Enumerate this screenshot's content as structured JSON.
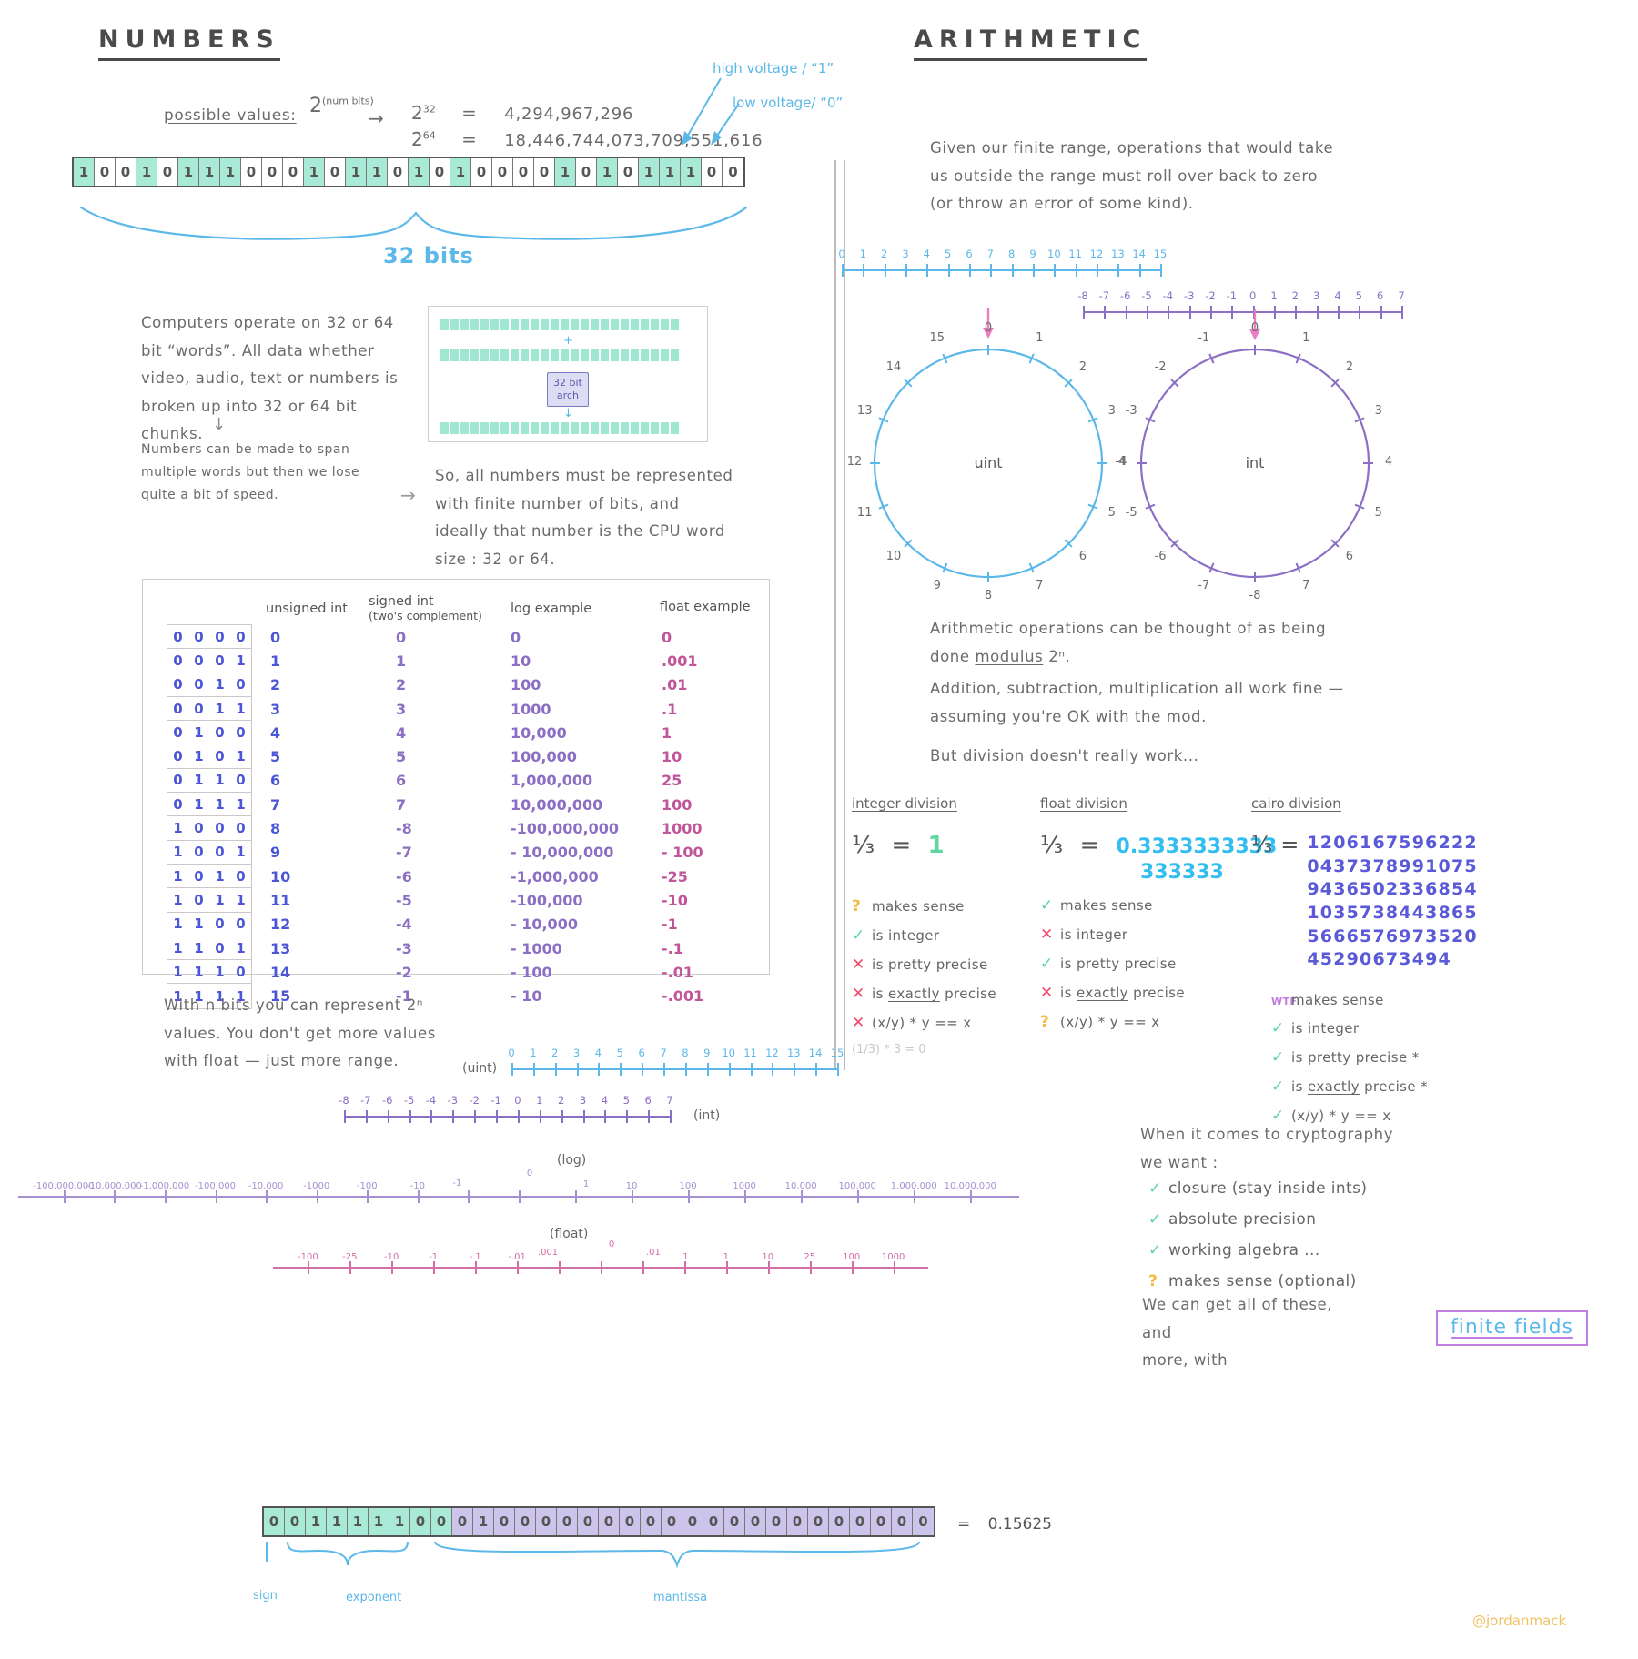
{
  "sections": {
    "left_title": "NUMBERS",
    "right_title": "ARITHMETIC"
  },
  "numbers": {
    "possible_values_label": "possible values:",
    "formula_base": "2",
    "formula_exp": "(num bits)",
    "arrow": "→",
    "rows": [
      {
        "power": "2",
        "exp": "32",
        "eq": "=",
        "value": "4,294,967,296"
      },
      {
        "power": "2",
        "exp": "64",
        "eq": "=",
        "value": "18,446,744,073,709,551,616"
      }
    ],
    "voltage_high": "high voltage / “1”",
    "voltage_low": "low voltage/ “0”",
    "bits32": [
      1,
      0,
      0,
      1,
      0,
      1,
      1,
      1,
      0,
      0,
      0,
      1,
      0,
      1,
      1,
      0,
      1,
      0,
      1,
      0,
      0,
      0,
      0,
      1,
      0,
      1,
      0,
      1,
      1,
      1,
      0,
      0
    ],
    "brace_label": "32 bits",
    "words_paragraph": "Computers operate on 32 or 64 bit “words”.  All data whether  video, audio, text or numbers is broken up into 32 or 64 bit chunks.",
    "span_paragraph": "Numbers can be made to span multiple words but then we lose quite a bit of speed.",
    "arch_chip_line1": "32 bit",
    "arch_chip_line2": "arch",
    "arch_plus": "+",
    "arch_down": "↓",
    "finite_paragraph": "So,  all  numbers  must be represented with finite number of bits, and ideally that number is the CPU word size :  32  or  64.",
    "with_n_bits_paragraph": "With n bits you can represent 2ⁿ values. You don't get more values with float — just more range."
  },
  "table": {
    "headers": [
      "unsigned int",
      "signed int\n(two's complement)",
      "log example",
      "float example"
    ],
    "header_signed_top": "signed int",
    "header_signed_bot": "(two's complement)",
    "rows": [
      {
        "bits": "0 0 0 0",
        "unsigned": "0",
        "signed": "0",
        "log": "0",
        "float": "0"
      },
      {
        "bits": "0 0 0 1",
        "unsigned": "1",
        "signed": "1",
        "log": "10",
        "float": ".001"
      },
      {
        "bits": "0 0 1 0",
        "unsigned": "2",
        "signed": "2",
        "log": "100",
        "float": ".01"
      },
      {
        "bits": "0 0 1 1",
        "unsigned": "3",
        "signed": "3",
        "log": "1000",
        "float": ".1"
      },
      {
        "bits": "0 1 0 0",
        "unsigned": "4",
        "signed": "4",
        "log": "10,000",
        "float": "1"
      },
      {
        "bits": "0 1 0 1",
        "unsigned": "5",
        "signed": "5",
        "log": "100,000",
        "float": "10"
      },
      {
        "bits": "0 1 1 0",
        "unsigned": "6",
        "signed": "6",
        "log": "1,000,000",
        "float": "25"
      },
      {
        "bits": "0 1 1 1",
        "unsigned": "7",
        "signed": "7",
        "log": "10,000,000",
        "float": "100"
      },
      {
        "bits": "1 0 0 0",
        "unsigned": "8",
        "signed": "-8",
        "log": "-100,000,000",
        "float": "1000"
      },
      {
        "bits": "1 0 0 1",
        "unsigned": "9",
        "signed": "-7",
        "log": "- 10,000,000",
        "float": "- 100"
      },
      {
        "bits": "1 0 1 0",
        "unsigned": "10",
        "signed": "-6",
        "log": "-1,000,000",
        "float": "-25"
      },
      {
        "bits": "1 0 1 1",
        "unsigned": "11",
        "signed": "-5",
        "log": "-100,000",
        "float": "-10"
      },
      {
        "bits": "1 1 0 0",
        "unsigned": "12",
        "signed": "-4",
        "log": "- 10,000",
        "float": "-1"
      },
      {
        "bits": "1 1 0 1",
        "unsigned": "13",
        "signed": "-3",
        "log": "- 1000",
        "float": "-.1"
      },
      {
        "bits": "1 1 1 0",
        "unsigned": "14",
        "signed": "-2",
        "log": "- 100",
        "float": "-.01"
      },
      {
        "bits": "1 1 1 1",
        "unsigned": "15",
        "signed": "-1",
        "log": "- 10",
        "float": "-.001"
      }
    ]
  },
  "arithmetic": {
    "intro_paragraph": "Given our finite range, operations that would take us outside the range must roll over back to zero (or throw an error of some kind).",
    "uint_line_ticks": [
      "0",
      "1",
      "2",
      "3",
      "4",
      "5",
      "6",
      "7",
      "8",
      "9",
      "10",
      "11",
      "12",
      "13",
      "14",
      "15"
    ],
    "int_line_ticks": [
      "-8",
      "-7",
      "-6",
      "-5",
      "-4",
      "-3",
      "-2",
      "-1",
      "0",
      "1",
      "2",
      "3",
      "4",
      "5",
      "6",
      "7"
    ],
    "uint_circle_label": "uint",
    "int_circle_label": "int",
    "uint_circle_values": [
      "0",
      "1",
      "2",
      "3",
      "4",
      "5",
      "6",
      "7",
      "8",
      "9",
      "10",
      "11",
      "12",
      "13",
      "14",
      "15"
    ],
    "int_circle_values": [
      "0",
      "1",
      "2",
      "3",
      "4",
      "5",
      "6",
      "7",
      "-8",
      "-7",
      "-6",
      "-5",
      "-4",
      "-3",
      "-2",
      "-1"
    ],
    "modulus_paragraph_a": "Arithmetic operations can be thought of as being done",
    "modulus_underline": "modulus",
    "modulus_pow": "2ⁿ",
    "modulus_period": ".",
    "addition_paragraph": "Addition, subtraction, multiplication  all  work fine — assuming you're OK  with  the  mod.",
    "division_paragraph": "But  division  doesn't  really  work..."
  },
  "division": {
    "columns": [
      {
        "title": "integer division",
        "expr_lhs": "¹⁄₃",
        "eq": "=",
        "result": "1",
        "result_color": "#5ed6a0",
        "checks": [
          {
            "mark": "?",
            "type": "q",
            "label": "makes sense"
          },
          {
            "mark": "✓",
            "type": "check",
            "label": "is integer"
          },
          {
            "mark": "✕",
            "type": "x",
            "label": "is pretty precise"
          },
          {
            "mark": "✕",
            "type": "x",
            "label": "is exactly precise",
            "underline": "exactly"
          },
          {
            "mark": "✕",
            "type": "x",
            "label": "(x/y) * y == x"
          }
        ],
        "footnote": "(1/3) * 3 = 0"
      },
      {
        "title": "float division",
        "expr_lhs": "¹⁄₃",
        "eq": "=",
        "result": "0.3333333333",
        "result_line2": "333333",
        "result_color": "#33bdf0",
        "checks": [
          {
            "mark": "✓",
            "type": "check",
            "label": "makes sense"
          },
          {
            "mark": "✕",
            "type": "x",
            "label": "is integer"
          },
          {
            "mark": "✓",
            "type": "check",
            "label": "is pretty precise"
          },
          {
            "mark": "✕",
            "type": "x",
            "label": "is exactly precise",
            "underline": "exactly"
          },
          {
            "mark": "?",
            "type": "q",
            "label": "(x/y) * y == x"
          }
        ],
        "footnote": ""
      },
      {
        "title": "cairo division",
        "expr_lhs": "¹⁄₃",
        "eq": "=",
        "result_lines": [
          "1206167596222",
          "0437378991075",
          "9436502336854",
          "1035738443865",
          "5666576973520",
          "45290673494"
        ],
        "result_color": "#5a5ad8",
        "checks": [
          {
            "mark": "WTF",
            "type": "wtf",
            "label": "makes sense"
          },
          {
            "mark": "✓",
            "type": "check",
            "label": "is integer"
          },
          {
            "mark": "✓",
            "type": "check",
            "label": "is pretty precise *"
          },
          {
            "mark": "✓",
            "type": "check",
            "label": "is exactly precise *",
            "underline": "exactly"
          },
          {
            "mark": "✓",
            "type": "check",
            "label": "(x/y) * y == x"
          }
        ],
        "footnote": ""
      }
    ]
  },
  "crypto": {
    "intro": "When it comes to cryptography we want :",
    "wants": [
      {
        "mark": "✓",
        "label": "closure (stay inside ints)"
      },
      {
        "mark": "✓",
        "label": "absolute precision"
      },
      {
        "mark": "✓",
        "label": "working  algebra ..."
      },
      {
        "mark": "?",
        "label": "makes sense (optional)"
      }
    ],
    "outro_a": "We can get all of these, and",
    "outro_b": "more,  with",
    "finite_fields": "finite fields"
  },
  "numberlines": {
    "uint": {
      "label": "(uint)",
      "ticks": [
        "0",
        "1",
        "2",
        "3",
        "4",
        "5",
        "6",
        "7",
        "8",
        "9",
        "10",
        "11",
        "12",
        "13",
        "14",
        "15"
      ]
    },
    "int": {
      "label": "(int)",
      "ticks": [
        "-8",
        "-7",
        "-6",
        "-5",
        "-4",
        "-3",
        "-2",
        "-1",
        "0",
        "1",
        "2",
        "3",
        "4",
        "5",
        "6",
        "7"
      ]
    },
    "log": {
      "label": "(log)",
      "ticks_left": [
        "-100,000,000",
        "-10,000,000",
        "-1,000,000",
        "-100,000",
        "-10,000",
        "-1000",
        "-100",
        "-10",
        "-1"
      ],
      "ticks_center": [
        "0"
      ],
      "ticks_right": [
        "1",
        "10",
        "100",
        "1000",
        "10,000",
        "100,000",
        "1,000,000",
        "10,000,000"
      ]
    },
    "float": {
      "label": "(float)",
      "ticks_left": [
        "-100",
        "-25",
        "-10",
        "-1",
        "-.1",
        "-.01",
        ".001"
      ],
      "ticks_center": [
        "0"
      ],
      "ticks_right": [
        ".01",
        ".1",
        "1",
        "10",
        "25",
        "100",
        "1000"
      ]
    }
  },
  "floatbits": {
    "bits": "0 0 1 1 1 1 1 0 0 0 0 1 0 0 0 0 0 0 0 0 0 0 0 0 0 0 0 0 0 0 0 0",
    "sign_bits": [
      0
    ],
    "exponent_bits": [
      0,
      1,
      1,
      1,
      1,
      1,
      0,
      0
    ],
    "mantissa_bits": [
      0,
      1,
      0,
      0,
      0,
      0,
      0,
      0,
      0,
      0,
      0,
      0,
      0,
      0,
      0,
      0,
      0,
      0,
      0,
      0,
      0,
      0,
      0
    ],
    "equals": "=",
    "value": "0.15625",
    "label_sign": "sign",
    "label_exponent": "exponent",
    "label_mantissa": "mantissa"
  },
  "signature": "@jordanmack",
  "colors": {
    "mint": "#a8ead6",
    "lavender": "#cdc4ec",
    "blue_ink": "#5bb8e8",
    "indigo": "#4b56d6",
    "violet": "#8b6fc4",
    "pink": "#c0559a",
    "green_check": "#5ed6a0",
    "red_x": "#ef4a6b",
    "amber_q": "#f5b942"
  }
}
